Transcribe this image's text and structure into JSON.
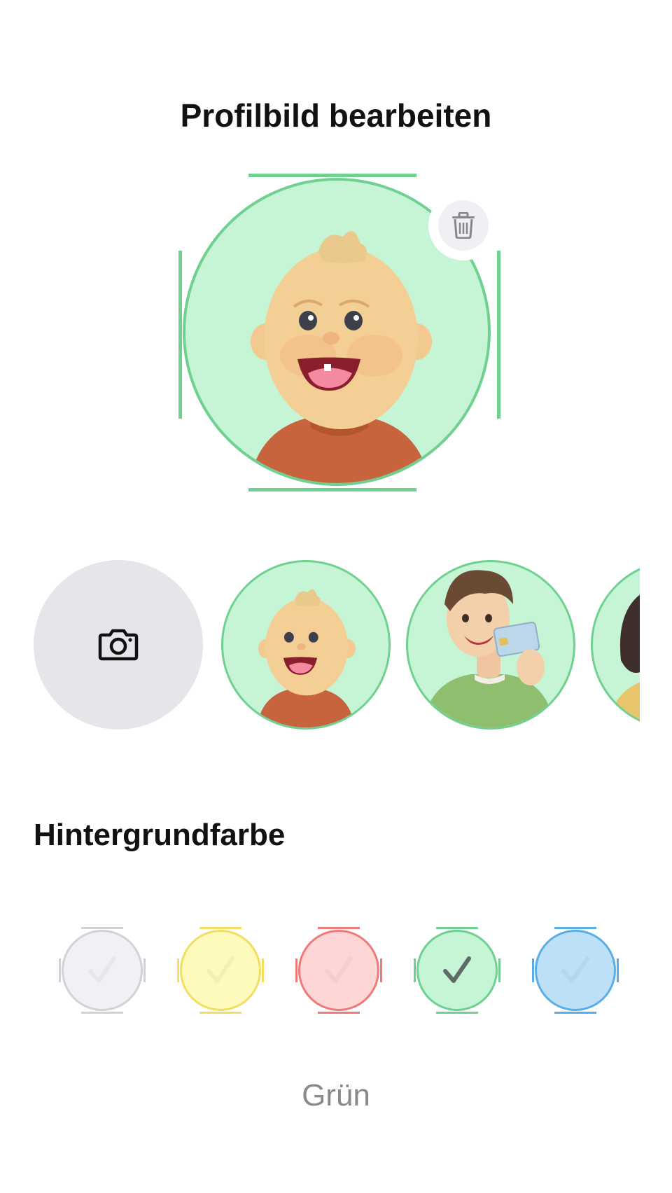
{
  "header": {
    "title": "Profilbild bearbeiten"
  },
  "preview": {
    "selected_avatar": "baby-avatar",
    "background_color": "#c5f5d5",
    "ring_color": "#6fd08f",
    "delete_icon": "trash-icon"
  },
  "avatar_picker": {
    "camera_icon": "camera-icon",
    "items": [
      {
        "name": "baby-avatar"
      },
      {
        "name": "boy-with-id-card-avatar"
      },
      {
        "name": "woman-avatar"
      }
    ]
  },
  "background": {
    "section_title": "Hintergrundfarbe",
    "selected_label": "Grün",
    "swatches": [
      {
        "fill": "#f0f0f5",
        "border": "#d2d2d7",
        "selected": false
      },
      {
        "fill": "#fdfabb",
        "border": "#f2df62",
        "selected": false
      },
      {
        "fill": "#ffd6d6",
        "border": "#f07a7a",
        "selected": false
      },
      {
        "fill": "#c5f5d5",
        "border": "#6fd08f",
        "selected": true
      },
      {
        "fill": "#bde0f7",
        "border": "#5aaee6",
        "selected": false
      }
    ]
  }
}
